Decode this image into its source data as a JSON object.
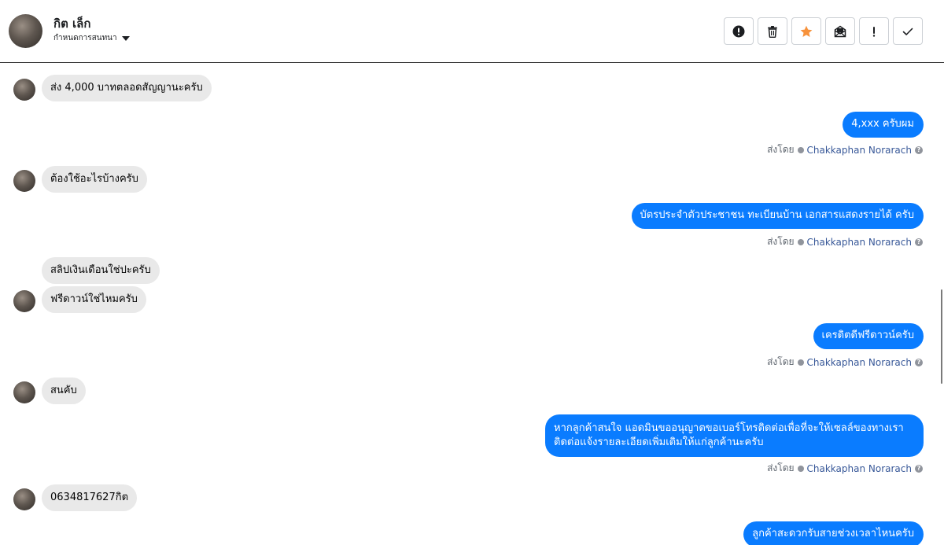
{
  "header": {
    "contact_name": "กิต เล็ก",
    "assign_label": "กำหนดการสนทนา"
  },
  "toolbar": {
    "buttons": [
      "alert-circle-icon",
      "trash-icon",
      "star-icon",
      "mark-unread-icon",
      "exclamation-icon",
      "check-icon"
    ],
    "star_color": "#f7923b"
  },
  "messages": [
    {
      "dir": "in",
      "text": "ส่ง 4,000 บาทตลอดสัญญานะครับ"
    },
    {
      "dir": "out",
      "text": "4,xxx ครับผม",
      "sent_prefix": "ส่งโดย",
      "sender": "Chakkaphan Norarach"
    },
    {
      "dir": "in",
      "text": "ต้องใช้อะไรบ้างครับ"
    },
    {
      "dir": "out",
      "text": "บัตรประจำตัวประชาชน ทะเบียนบ้าน เอกสารแสดงรายได้ ครับ",
      "sent_prefix": "ส่งโดย",
      "sender": "Chakkaphan Norarach"
    },
    {
      "dir": "in",
      "text": "สลิปเงินเดือนใช่ปะครับ"
    },
    {
      "dir": "in",
      "text": "ฟรีดาวน์ใช่ไหมครับ"
    },
    {
      "dir": "out",
      "text": "เครดิตดีฟรีดาวน์ครับ",
      "sent_prefix": "ส่งโดย",
      "sender": "Chakkaphan Norarach"
    },
    {
      "dir": "in",
      "text": "สนคับ"
    },
    {
      "dir": "out",
      "text": "หากลูกค้าสนใจ แอดมินขออนุญาตขอเบอร์โทรติดต่อเพื่อที่จะให้เซลล์ของทางเราติดต่อแจ้งรายละเอียดเพิ่มเติมให้แก่ลูกค้านะครับ",
      "sent_prefix": "ส่งโดย",
      "sender": "Chakkaphan Norarach"
    },
    {
      "dir": "in",
      "text": "0634817627กิต"
    },
    {
      "dir": "out",
      "text": "ลูกค้าสะดวกรับสายช่วงเวลาไหนครับ"
    }
  ],
  "colors": {
    "outgoing_bubble": "#0a7cff",
    "incoming_bubble": "#e9e9e9",
    "sender_link": "#385898"
  }
}
